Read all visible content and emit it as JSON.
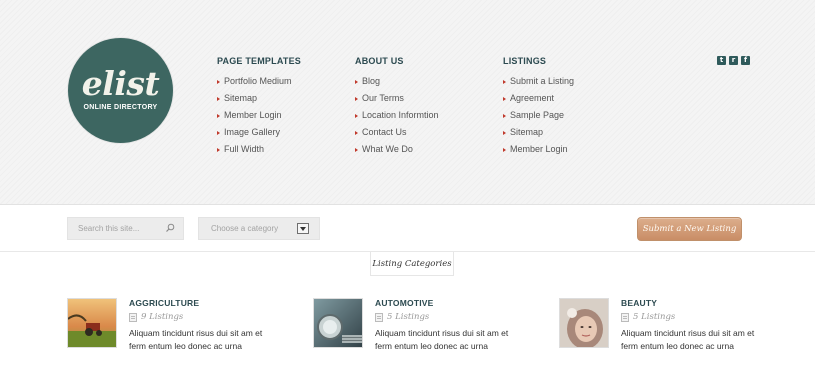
{
  "logo": {
    "word": "elist",
    "tagline": "ONLINE DIRECTORY"
  },
  "menus": [
    {
      "heading": "PAGE TEMPLATES",
      "items": [
        "Portfolio Medium",
        "Sitemap",
        "Member Login",
        "Image Gallery",
        "Full Width"
      ]
    },
    {
      "heading": "ABOUT US",
      "items": [
        "Blog",
        "Our Terms",
        "Location Informtion",
        "Contact Us",
        "What We Do"
      ]
    },
    {
      "heading": "LISTINGS",
      "items": [
        "Submit a Listing",
        "Agreement",
        "Sample Page",
        "Sitemap",
        "Member Login"
      ]
    }
  ],
  "social": {
    "icons": [
      "twitter-icon",
      "rss-icon",
      "facebook-icon"
    ],
    "glyphs": [
      "t",
      "r",
      "f"
    ]
  },
  "search": {
    "placeholder": "Search this site..."
  },
  "category_select": {
    "selected": "Choose a category"
  },
  "submit_button": "Submit a New Listing",
  "listing_categories_tab": "Listing Categories",
  "categories": [
    {
      "name": "AGGRICULTURE",
      "count": "9 Listings",
      "desc": "Aliquam tincidunt risus dui sit am et ferm entum leo donec ac urna"
    },
    {
      "name": "AUTOMOTIVE",
      "count": "5 Listings",
      "desc": "Aliquam tincidunt risus dui sit am et ferm entum leo donec ac urna"
    },
    {
      "name": "BEAUTY",
      "count": "5 Listings",
      "desc": "Aliquam tincidunt risus dui sit am et ferm entum leo donec ac urna"
    }
  ],
  "colors": {
    "logo_bg": "#3d6661",
    "heading": "#2c4a50",
    "bullet": "#c0392b",
    "submit_bg": "#d09a74"
  }
}
